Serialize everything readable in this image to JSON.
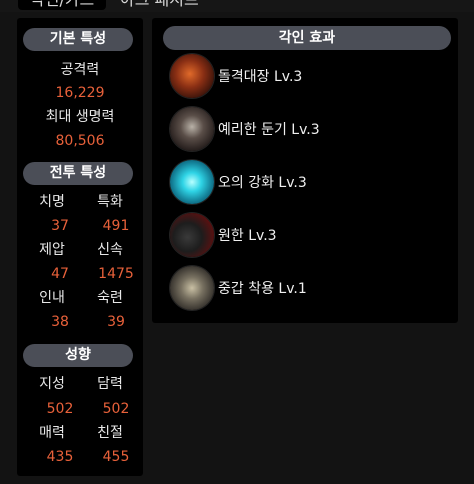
{
  "header": {
    "active_tab": "각인/카드",
    "other_tab": "아크 패시브"
  },
  "basic": {
    "title": "기본 특성",
    "attack_label": "공격력",
    "attack_value": "16,229",
    "hp_label": "최대 생명력",
    "hp_value": "80,506"
  },
  "combat": {
    "title": "전투 특성",
    "stats": [
      {
        "label": "치명",
        "value": "37"
      },
      {
        "label": "특화",
        "value": "491"
      },
      {
        "label": "제압",
        "value": "47"
      },
      {
        "label": "신속",
        "value": "1475"
      },
      {
        "label": "인내",
        "value": "38"
      },
      {
        "label": "숙련",
        "value": "39"
      }
    ]
  },
  "tendency": {
    "title": "성향",
    "stats": [
      {
        "label": "지성",
        "value": "502"
      },
      {
        "label": "담력",
        "value": "502"
      },
      {
        "label": "매력",
        "value": "435"
      },
      {
        "label": "친절",
        "value": "455"
      }
    ]
  },
  "engravings": {
    "title": "각인 효과",
    "items": [
      {
        "name": "돌격대장 Lv.3",
        "icon": "charge-commander-icon",
        "color": "#e06a2a"
      },
      {
        "name": "예리한 둔기 Lv.3",
        "icon": "keen-blunt-weapon-icon",
        "color": "#b9b2a8"
      },
      {
        "name": "오의 강화 Lv.3",
        "icon": "esoteric-enhancement-icon",
        "color": "#2fd4e6"
      },
      {
        "name": "원한 Lv.3",
        "icon": "grudge-icon",
        "color": "#5a1010"
      },
      {
        "name": "중갑 착용 Lv.1",
        "icon": "heavy-armor-icon",
        "color": "#c9c0a4"
      }
    ]
  },
  "colors": {
    "value_text": "#e8613a",
    "pill_bg": "#4b4e57",
    "panel_bg": "#000000",
    "page_bg": "#131313"
  }
}
